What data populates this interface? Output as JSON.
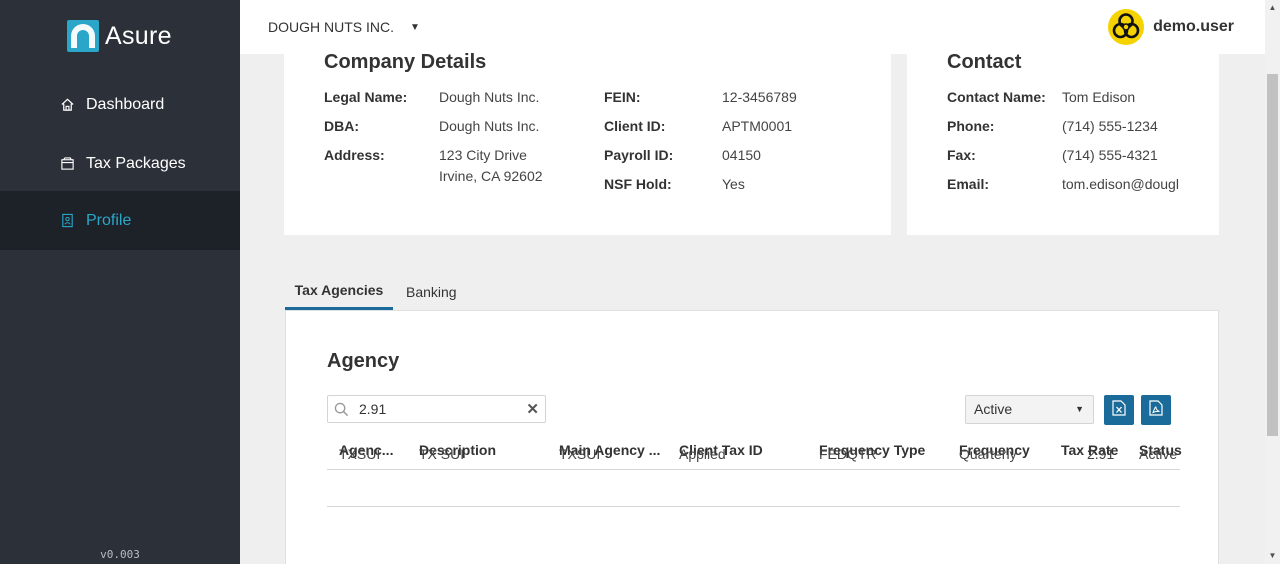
{
  "app": {
    "brand": "Asure",
    "version": "v0.003"
  },
  "sidebar": {
    "items": [
      {
        "label": "Dashboard",
        "icon": "home-icon"
      },
      {
        "label": "Tax Packages",
        "icon": "package-icon"
      },
      {
        "label": "Profile",
        "icon": "profile-badge-icon",
        "active": true
      }
    ]
  },
  "header": {
    "company": "DOUGH NUTS INC.",
    "user": {
      "name": "demo.user",
      "avatar_icon": "biohazard-icon"
    }
  },
  "company_details": {
    "title": "Company Details",
    "legal_name_label": "Legal Name:",
    "legal_name": "Dough Nuts Inc.",
    "dba_label": "DBA:",
    "dba": "Dough Nuts Inc.",
    "address_label": "Address:",
    "address_line1": "123 City Drive",
    "address_line2": "Irvine, CA 92602",
    "fein_label": "FEIN:",
    "fein": "12-3456789",
    "client_id_label": "Client ID:",
    "client_id": "APTM0001",
    "payroll_id_label": "Payroll ID:",
    "payroll_id": "04150",
    "nsf_hold_label": "NSF Hold:",
    "nsf_hold": "Yes"
  },
  "contact": {
    "title": "Contact",
    "name_label": "Contact Name:",
    "name": "Tom Edison",
    "phone_label": "Phone:",
    "phone": "(714) 555-1234",
    "fax_label": "Fax:",
    "fax": "(714) 555-4321",
    "email_label": "Email:",
    "email": "tom.edison@dougl"
  },
  "tabs": [
    {
      "label": "Tax Agencies",
      "active": true
    },
    {
      "label": "Banking"
    }
  ],
  "agency": {
    "title": "Agency",
    "search_value": "2.91",
    "status_filter": "Active",
    "export_excel_icon": "excel-file-icon",
    "export_pdf_icon": "pdf-file-icon",
    "columns": [
      "Agenc...",
      "Description",
      "Main Agency ...",
      "Client Tax ID",
      "Frequency Type",
      "Frequency",
      "Tax Rate",
      "Status"
    ],
    "rows": [
      [
        "TXSUI",
        "TX SUI",
        "TXSUI",
        "Applied",
        "FEDQTR",
        "Quarterly",
        "2.91",
        "Active"
      ]
    ]
  },
  "colors": {
    "sidebar": "#2c3039",
    "accent": "#2aa6c9",
    "button": "#1a6b99"
  }
}
